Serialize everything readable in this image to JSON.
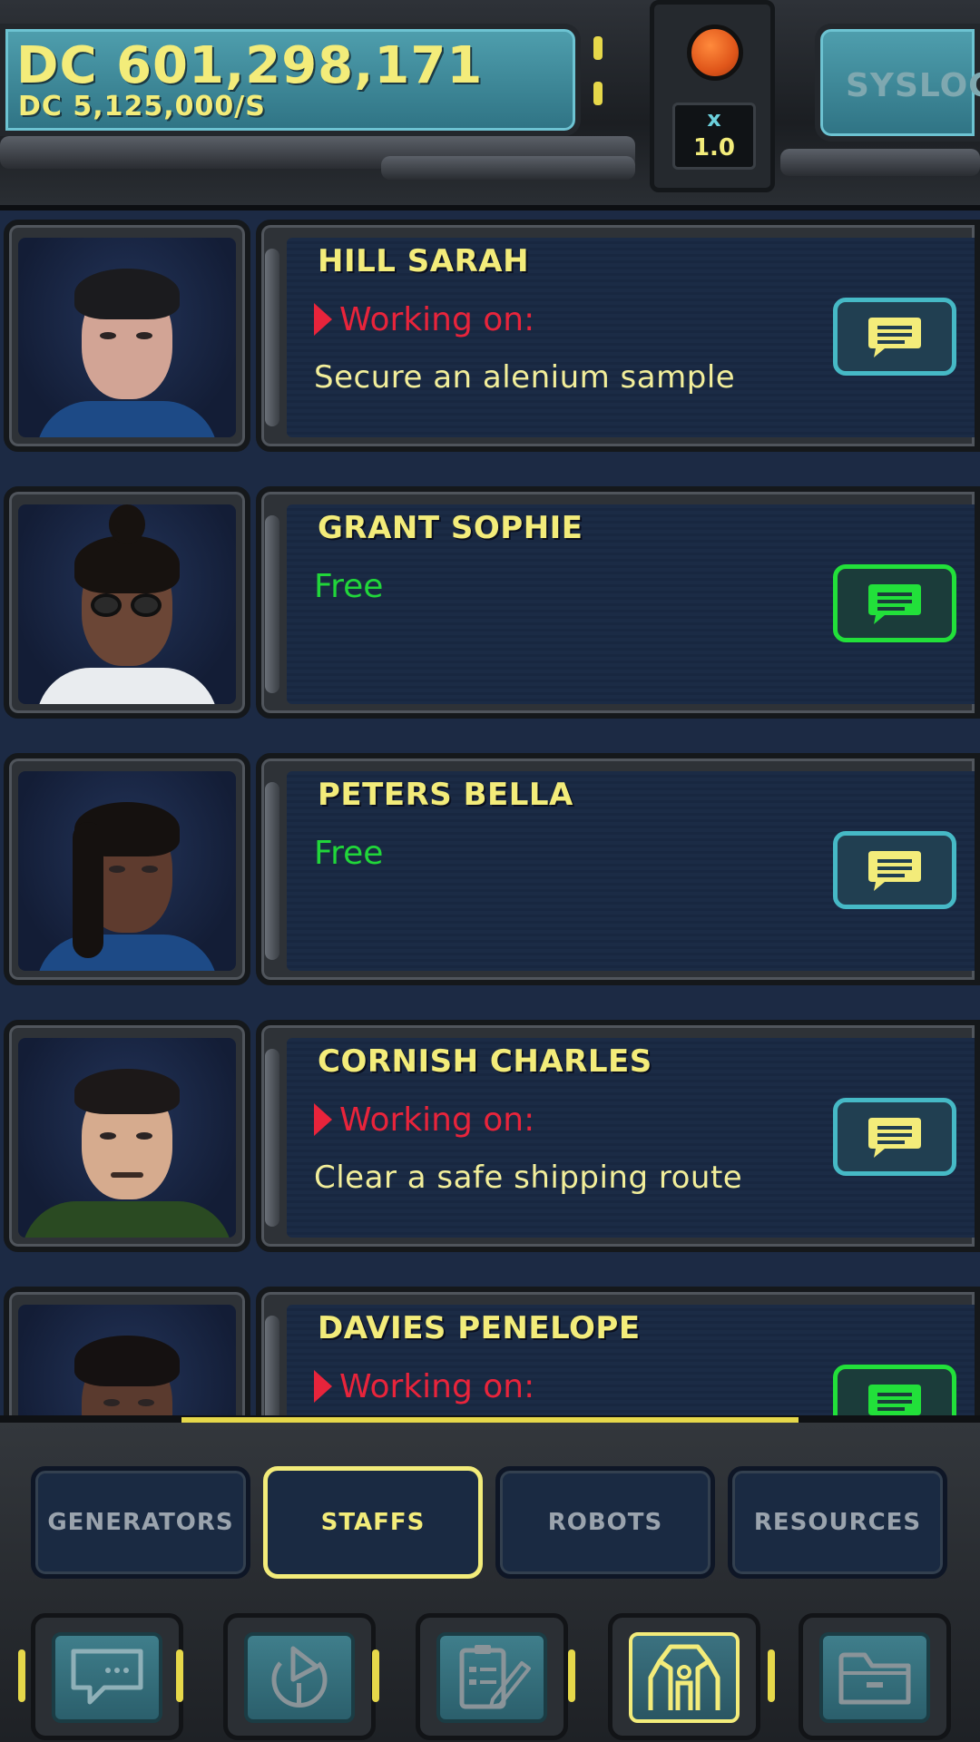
{
  "hud": {
    "currency_total": "DC 601,298,171",
    "currency_rate": "DC 5,125,000/S",
    "speed_multiplier_symbol": "x",
    "speed_multiplier_value": "1.0",
    "syslog_label": "SYSLOG"
  },
  "staff": [
    {
      "name": "HILL SARAH",
      "status": "working",
      "status_label": "Working on:",
      "task": "Secure an alenium sample",
      "chat_active": false
    },
    {
      "name": "GRANT SOPHIE",
      "status": "free",
      "status_label": "Free",
      "task": "",
      "chat_active": true
    },
    {
      "name": "PETERS BELLA",
      "status": "free",
      "status_label": "Free",
      "task": "",
      "chat_active": false
    },
    {
      "name": "CORNISH CHARLES",
      "status": "working",
      "status_label": "Working on:",
      "task": "Clear a safe shipping route",
      "chat_active": false
    },
    {
      "name": "DAVIES PENELOPE",
      "status": "working",
      "status_label": "Working on:",
      "task": "",
      "chat_active": true
    }
  ],
  "tabs": [
    {
      "label": "GENERATORS",
      "active": false
    },
    {
      "label": "STAFFS",
      "active": true
    },
    {
      "label": "ROBOTS",
      "active": false
    },
    {
      "label": "RESOURCES",
      "active": false
    }
  ],
  "nav_icons": [
    {
      "icon": "chat-terminal-icon",
      "active": false
    },
    {
      "icon": "refresh-play-icon",
      "active": false
    },
    {
      "icon": "clipboard-edit-icon",
      "active": false
    },
    {
      "icon": "staff-gate-icon",
      "active": true
    },
    {
      "icon": "folder-icon",
      "active": false
    }
  ],
  "colors": {
    "accent_yellow": "#f3ec7a",
    "working_red": "#e8243b",
    "free_green": "#21d63a",
    "chat_cyan": "#46b9c6",
    "chat_active_green": "#22e03a"
  }
}
